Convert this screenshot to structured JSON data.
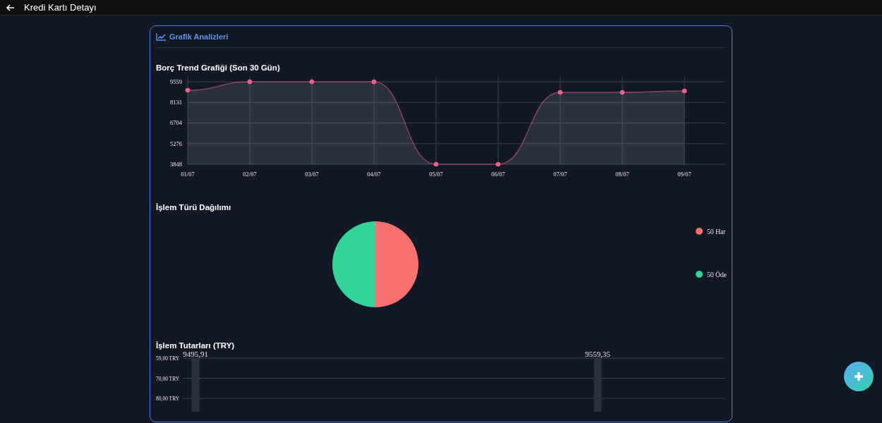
{
  "header": {
    "title": "Kredi Kartı Detayı"
  },
  "card": {
    "title": "Grafik Analizleri"
  },
  "debt_trend": {
    "title": "Borç Trend Grafiği (Son 30 Gün)",
    "chart_data": {
      "type": "area",
      "categories": [
        "01/07",
        "02/07",
        "03/07",
        "04/07",
        "05/07",
        "06/07",
        "07/07",
        "08/07",
        "09/07"
      ],
      "series": [
        {
          "color": "#f0628c",
          "values": [
            8970,
            9559,
            9559,
            9559,
            3848,
            3848,
            8830,
            8830,
            8920
          ]
        }
      ],
      "ylim": [
        3848,
        9559
      ],
      "yticks": [
        3848,
        5276,
        6704,
        8131,
        9559
      ],
      "grid": true
    }
  },
  "type_distribution": {
    "title": "İşlem Türü Dağılımı",
    "chart_data": {
      "type": "pie",
      "categories": [
        "50 Har",
        "50 Öde"
      ],
      "values": [
        50,
        50
      ],
      "colors": [
        "#f87171",
        "#34d399"
      ],
      "legend": "right"
    }
  },
  "amounts": {
    "title": "İşlem Tutarları (TRY)",
    "axis_labels": [
      "59,00 TRY",
      "70,00 TRY",
      "80,00 TRY"
    ],
    "value_labels": [
      "9495,91",
      "9559,35"
    ]
  }
}
